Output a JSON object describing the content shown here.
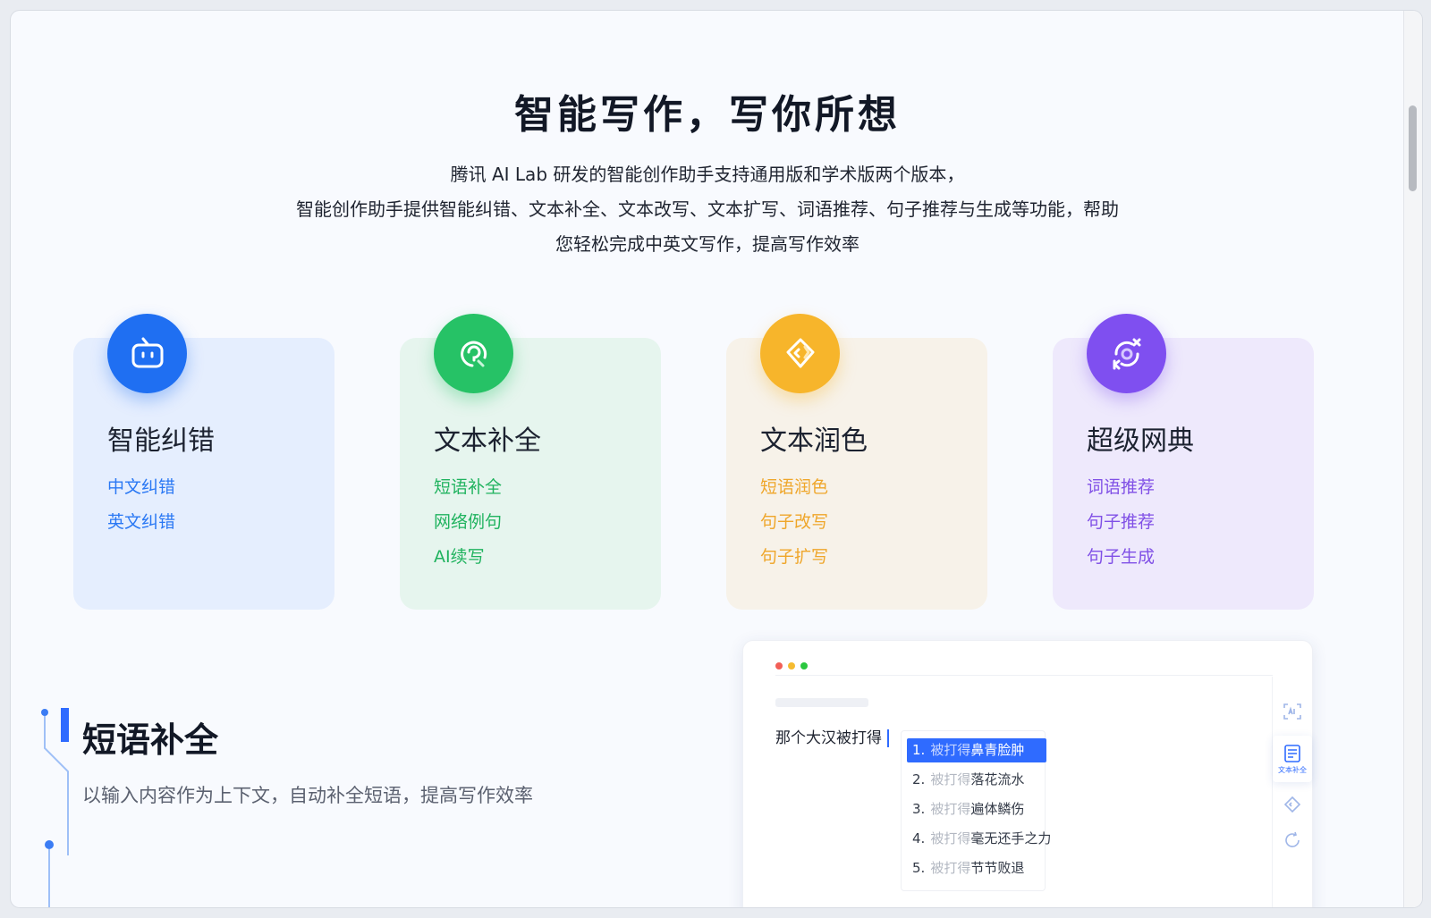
{
  "hero": {
    "title": "智能写作，写你所想",
    "desc_lines": [
      "腾讯 AI Lab 研发的智能创作助手支持通用版和学术版两个版本，",
      "智能创作助手提供智能纠错、文本补全、文本改写、文本扩写、词语推荐、句子推荐与生成等功能，帮助",
      "您轻松完成中英文写作，提高写作效率"
    ]
  },
  "cards": [
    {
      "title": "智能纠错",
      "links": [
        "中文纠错",
        "英文纠错"
      ],
      "icon": "robot-face-icon",
      "accent": "#2a78f4",
      "bg": "#e5eefe",
      "badge": "#1f6ff2"
    },
    {
      "title": "文本补全",
      "links": [
        "短语补全",
        "网络例句",
        "AI续写"
      ],
      "icon": "chat-refresh-icon",
      "accent": "#20b35f",
      "bg": "#e6f5ee",
      "badge": "#26c266"
    },
    {
      "title": "文本润色",
      "links": [
        "短语润色",
        "句子改写",
        "句子扩写"
      ],
      "icon": "tag-diamond-icon",
      "accent": "#efa62a",
      "bg": "#f7f2e9",
      "badge": "#f7b52b"
    },
    {
      "title": "超级网典",
      "links": [
        "词语推荐",
        "句子推荐",
        "句子生成"
      ],
      "icon": "translate-cycle-icon",
      "accent": "#8050e6",
      "bg": "#eee9fc",
      "badge": "#7f4ff0"
    }
  ],
  "feature": {
    "title": "短语补全",
    "desc": "以输入内容作为上下文，自动补全短语，提高写作效率"
  },
  "demo": {
    "typed": "那个大汉被打得",
    "prefix": "被打得",
    "suggestions": [
      {
        "num": "1.",
        "completion": "鼻青脸肿"
      },
      {
        "num": "2.",
        "completion": "落花流水"
      },
      {
        "num": "3.",
        "completion": "遍体鳞伤"
      },
      {
        "num": "4.",
        "completion": "毫无还手之力"
      },
      {
        "num": "5.",
        "completion": "节节败退"
      }
    ],
    "tools": [
      "scan-text-icon",
      "text-complete-icon",
      "tag-icon",
      "refresh-icon"
    ],
    "active_tool_label": "文本补全"
  },
  "colors": {
    "primary": "#2f6bff",
    "text": "#1c2230"
  }
}
